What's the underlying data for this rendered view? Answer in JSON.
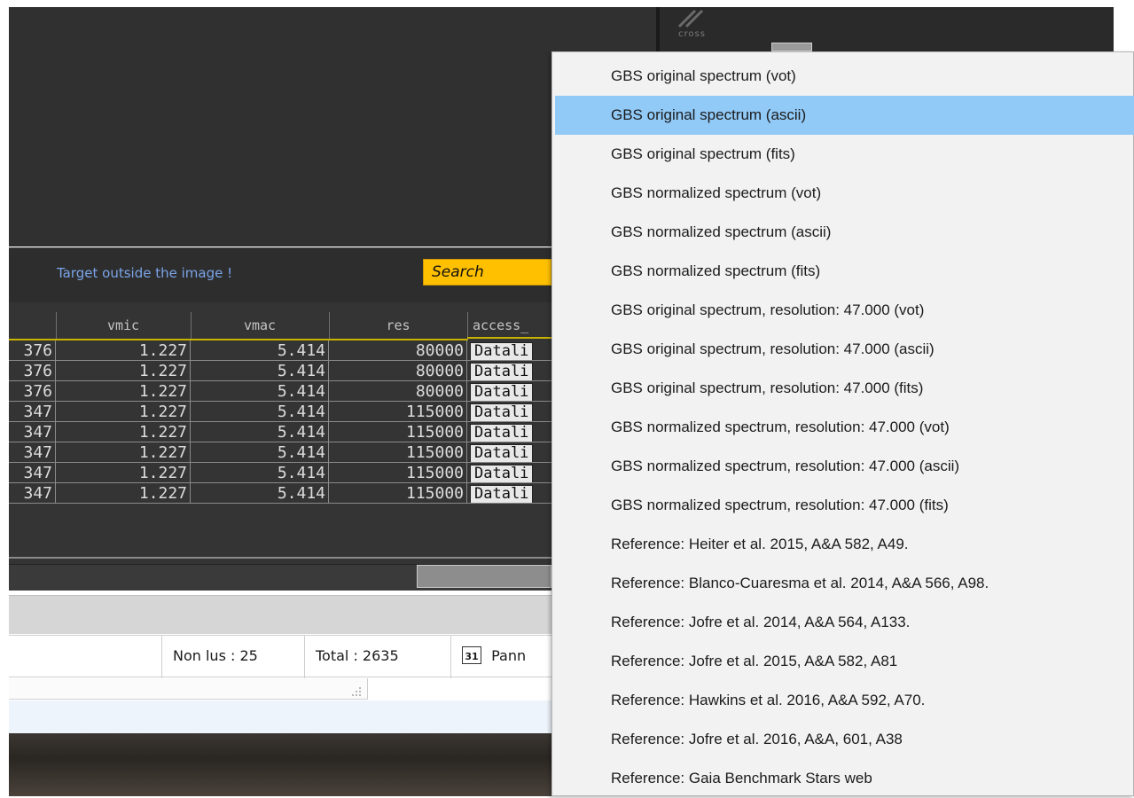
{
  "viewer": {
    "tool_label": "cross",
    "target_message": "Target outside the image !",
    "search_label": "Search"
  },
  "table": {
    "columns": [
      "vmic",
      "vmac",
      "res",
      "access_"
    ],
    "rows": [
      {
        "prev": "376",
        "vmic": "1.227",
        "vmac": "5.414",
        "res": "80000",
        "access": "Datali"
      },
      {
        "prev": "376",
        "vmic": "1.227",
        "vmac": "5.414",
        "res": "80000",
        "access": "Datali"
      },
      {
        "prev": "376",
        "vmic": "1.227",
        "vmac": "5.414",
        "res": "80000",
        "access": "Datali"
      },
      {
        "prev": "347",
        "vmic": "1.227",
        "vmac": "5.414",
        "res": "115000",
        "access": "Datali"
      },
      {
        "prev": "347",
        "vmic": "1.227",
        "vmac": "5.414",
        "res": "115000",
        "access": "Datali"
      },
      {
        "prev": "347",
        "vmic": "1.227",
        "vmac": "5.414",
        "res": "115000",
        "access": "Datali"
      },
      {
        "prev": "347",
        "vmic": "1.227",
        "vmac": "5.414",
        "res": "115000",
        "access": "Datali"
      },
      {
        "prev": "347",
        "vmic": "1.227",
        "vmac": "5.414",
        "res": "115000",
        "access": "Datali"
      }
    ]
  },
  "mail_status": {
    "unread": "Non lus : 25",
    "total": "Total : 2635",
    "calendar_day": "31",
    "panel": "Pann"
  },
  "menu": {
    "selected_index": 1,
    "items": [
      "GBS original spectrum (vot)",
      "GBS original  spectrum (ascii)",
      "GBS original  spectrum (fits)",
      "GBS normalized spectrum (vot)",
      "GBS normalized  spectrum (ascii)",
      "GBS normalized  spectrum (fits)",
      "GBS original  spectrum, resolution: 47.000 (vot)",
      "GBS original  spectrum, resolution: 47.000 (ascii)",
      "GBS original  spectrum, resolution: 47.000 (fits)",
      "GBS normalized  spectrum, resolution: 47.000 (vot)",
      "GBS normalized  spectrum, resolution: 47.000 (ascii)",
      "GBS  normalized spectrum, resolution: 47.000 (fits)",
      "Reference: Heiter et al. 2015, A&A 582, A49.",
      "Reference: Blanco-Cuaresma et al. 2014, A&A 566, A98.",
      "Reference: Jofre et al. 2014, A&A 564, A133.",
      "Reference: Jofre et al. 2015, A&A 582, A81",
      "Reference: Hawkins et al. 2016, A&A 592, A70.",
      "Reference: Jofre et al. 2016, A&A, 601, A38",
      "Reference: Gaia Benchmark Stars web"
    ]
  },
  "colors": {
    "search_bg": "#ffc000",
    "selection": "#91c9f7",
    "column_underline": "#c8b400",
    "message_text": "#7aa4e8"
  }
}
